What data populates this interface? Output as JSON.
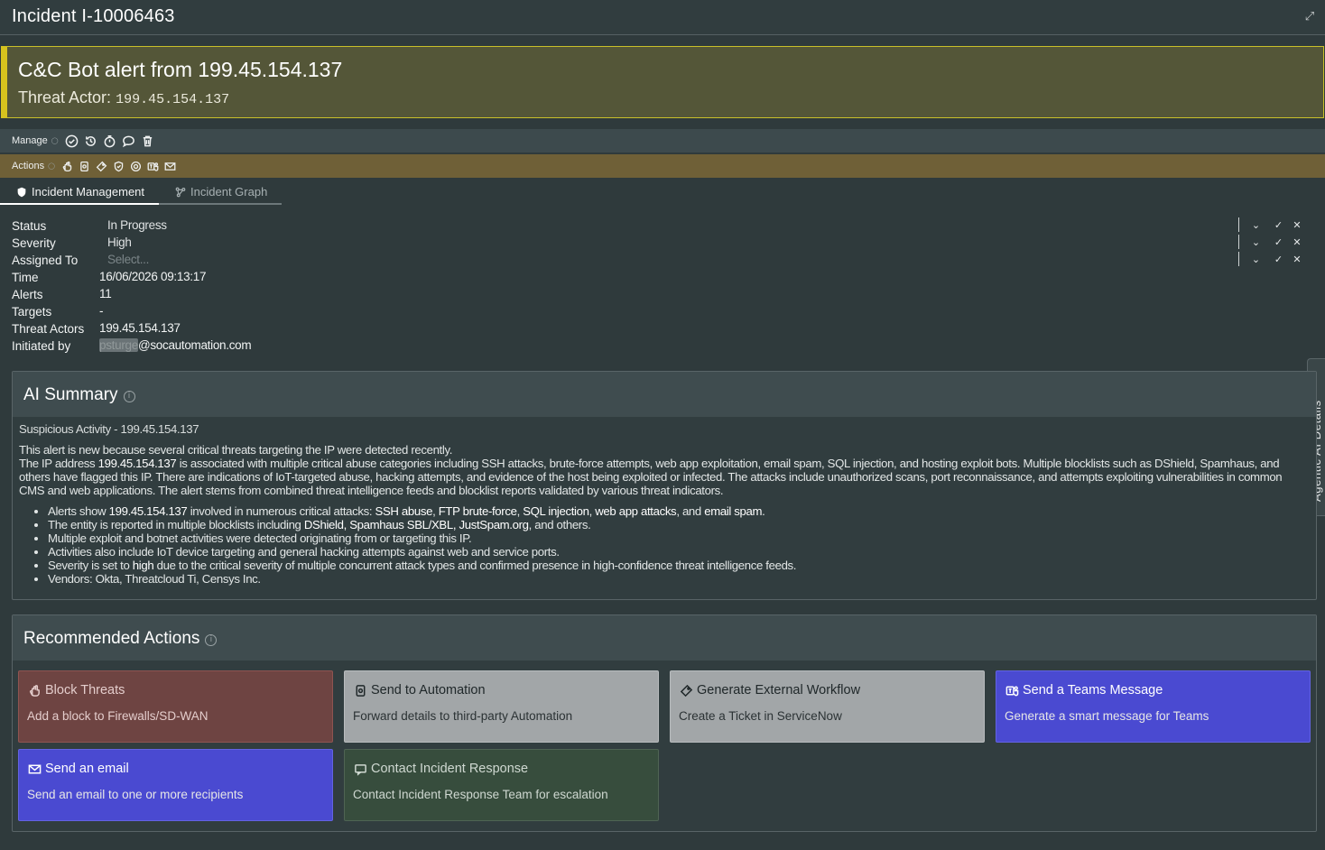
{
  "window": {
    "title": "Incident I-10006463",
    "expand_icon": "expand-icon"
  },
  "alert": {
    "headline": "C&C Bot alert from 199.45.154.137",
    "actor_label": "Threat Actor:",
    "actor_value": "199.45.154.137",
    "accent_color": "#d6c21e"
  },
  "toolbar": {
    "manage_label": "Manage",
    "actions_label": "Actions",
    "manage_icons": [
      "check-circle-icon",
      "history-icon",
      "timer-icon",
      "comment-icon",
      "trash-icon"
    ],
    "action_icons": [
      "hand-block-icon",
      "automation-icon",
      "ticket-icon",
      "shield-icon",
      "contact-icon",
      "teams-icon",
      "email-icon"
    ]
  },
  "tabs": [
    {
      "label": "Incident Management",
      "icon": "shield-icon",
      "active": true
    },
    {
      "label": "Incident Graph",
      "icon": "graph-icon",
      "active": false
    }
  ],
  "fields": {
    "status": {
      "label": "Status",
      "value": "In Progress"
    },
    "severity": {
      "label": "Severity",
      "value": "High"
    },
    "assigned": {
      "label": "Assigned To",
      "placeholder": "Select..."
    },
    "time": {
      "label": "Time",
      "value": "16/06/2026 09:13:17"
    },
    "alerts": {
      "label": "Alerts",
      "value": "11"
    },
    "targets": {
      "label": "Targets",
      "value": "-"
    },
    "threat_actors": {
      "label": "Threat Actors",
      "value": "199.45.154.137"
    },
    "initiated": {
      "label": "Initiated by",
      "value_redacted": "psturge",
      "value_domain": "@socautomation.com"
    }
  },
  "side_tab": {
    "label": "Agentic AI Details"
  },
  "ai_summary": {
    "title": "AI Summary",
    "subtitle": "Suspicious Activity - 199.45.154.137",
    "line1": "This alert is new because several critical threats targeting the IP were detected recently.",
    "p2_a": "The IP address ",
    "p2_ip": "199.45.154.137",
    "p2_b": " is associated with multiple critical abuse categories including SSH attacks, brute-force attempts, web app exploitation, email spam, SQL injection, and hosting exploit bots. Multiple blocklists such as DShield, Spamhaus, and others have flagged this IP. There are indications of IoT-targeted abuse, hacking attempts, and evidence of the host being exploited or infected. The attacks include unauthorized scans, port reconnaissance, and attempts exploiting vulnerabilities in common CMS and web applications. The alert stems from combined threat intelligence feeds and blocklist reports validated by various threat indicators.",
    "b1_a": "Alerts show ",
    "b1_ip": "199.45.154.137",
    "b1_b": " involved in numerous critical attacks: ",
    "b1_t1": "SSH abuse",
    "b1_sep1": ", ",
    "b1_t2": "FTP brute-force",
    "b1_sep2": ", ",
    "b1_t3": "SQL injection",
    "b1_sep3": ", ",
    "b1_t4": "web app attacks",
    "b1_and": ", and ",
    "b1_t5": "email spam",
    "b1_end": ".",
    "b2_a": "The entity is reported in multiple blocklists including ",
    "b2_lists": "DShield, Spamhaus SBL/XBL, JustSpam.org",
    "b2_b": ", and others.",
    "b3": "Multiple exploit and botnet activities were detected originating from or targeting this IP.",
    "b4": "Activities also include IoT device targeting and general hacking attempts against web and service ports.",
    "b5_a": "Severity is set to ",
    "b5_sev": "high",
    "b5_b": " due to the critical severity of multiple concurrent attack types and confirmed presence in high-confidence threat intelligence feeds.",
    "b6": "Vendors: Okta, Threatcloud Ti, Censys Inc."
  },
  "recommended": {
    "title": "Recommended Actions",
    "cards": [
      {
        "title": "Block Threats",
        "desc": "Add a block to Firewalls/SD-WAN",
        "icon": "hand-block-icon",
        "color": "#6e4442"
      },
      {
        "title": "Send to Automation",
        "desc": "Forward details to third-party Automation",
        "icon": "automation-icon",
        "color": "#a2a6a8"
      },
      {
        "title": "Generate External Workflow",
        "desc": "Create a Ticket in ServiceNow",
        "icon": "ticket-icon",
        "color": "#a2a6a8"
      },
      {
        "title": "Send a Teams Message",
        "desc": "Generate a smart message for Teams",
        "icon": "teams-icon",
        "color": "#4a4ad1"
      },
      {
        "title": "Send an email",
        "desc": "Send an email to one or more recipients",
        "icon": "email-icon",
        "color": "#4a4ad1"
      },
      {
        "title": "Contact Incident Response",
        "desc": "Contact Incident Response Team for escalation",
        "icon": "chat-icon",
        "color": "#374d3d"
      }
    ]
  }
}
